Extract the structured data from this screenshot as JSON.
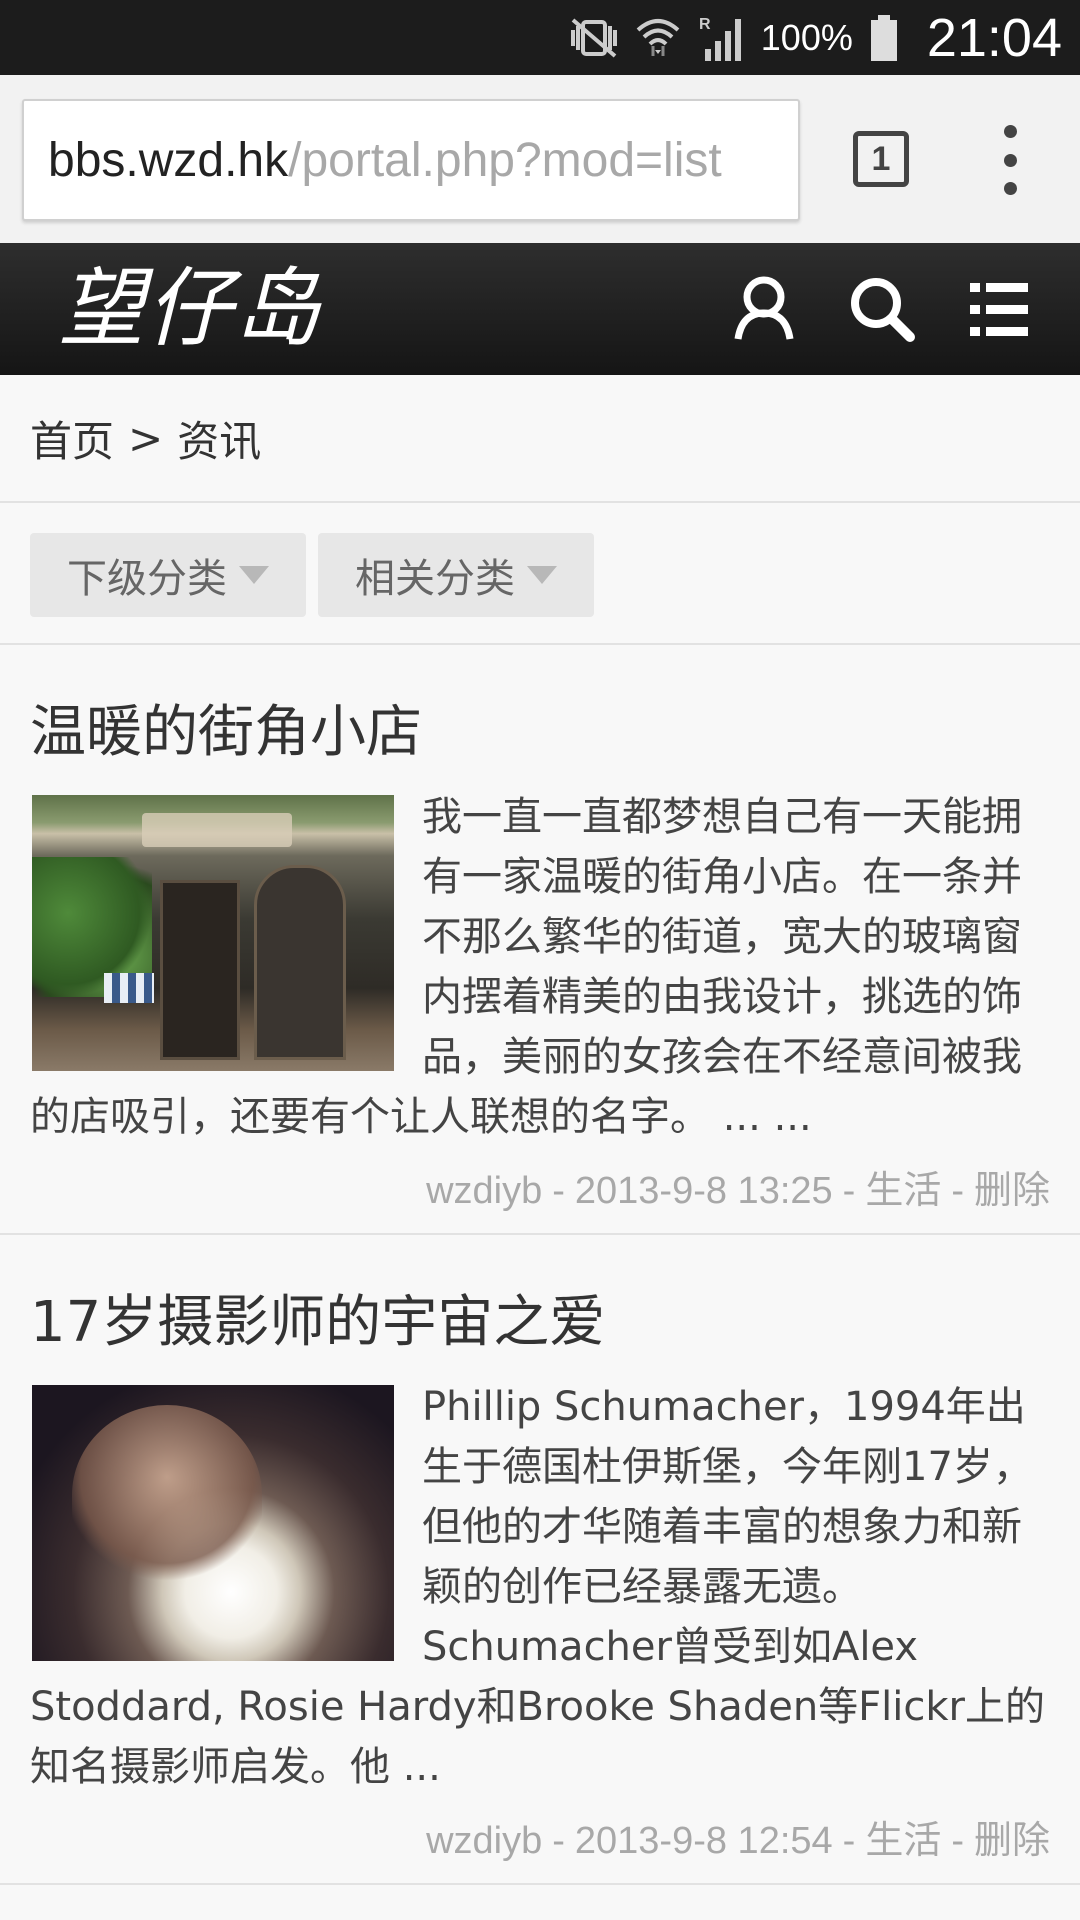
{
  "status_bar": {
    "battery_percent": "100%",
    "time": "21:04",
    "icons": [
      "vibrate-mute-icon",
      "wifi-icon",
      "signal-roaming-icon",
      "battery-icon"
    ]
  },
  "browser": {
    "url_host": "bbs.wzd.hk",
    "url_path": "/portal.php?mod=list",
    "tab_count": "1",
    "menu_icon": "more-vertical-icon"
  },
  "site": {
    "logo_text": "望仔岛",
    "icons": [
      "user-icon",
      "search-icon",
      "hamburger-menu-icon"
    ]
  },
  "breadcrumb": {
    "home": "首页",
    "separator": ">",
    "current": "资讯"
  },
  "filters": {
    "sub_category": "下级分类",
    "related_category": "相关分类"
  },
  "articles": [
    {
      "title": "温暖的街角小店",
      "excerpt": "我一直一直都梦想自己有一天能拥有一家温暖的街角小店。在一条并不那么繁华的街道，宽大的玻璃窗内摆着精美的由我设计，挑选的饰品，美丽的女孩会在不经意间被我的店吸引，还要有个让人联想的名字。 ... ...",
      "author": "wzdiyb",
      "datetime": "2013-9-8 13:25",
      "category": "生活",
      "action": "删除"
    },
    {
      "title": "17岁摄影师的宇宙之爱",
      "excerpt": "Phillip Schumacher，1994年出生于德国杜伊斯堡，今年刚17岁，但他的才华随着丰富的想象力和新颖的创作已经暴露无遗。Schumacher曾受到如Alex Stoddard, Rosie Hardy和Brooke Shaden等Flickr上的知名摄影师启发。他 ...",
      "author": "wzdiyb",
      "datetime": "2013-9-8 12:54",
      "category": "生活",
      "action": "删除"
    }
  ],
  "meta_separator": "-"
}
